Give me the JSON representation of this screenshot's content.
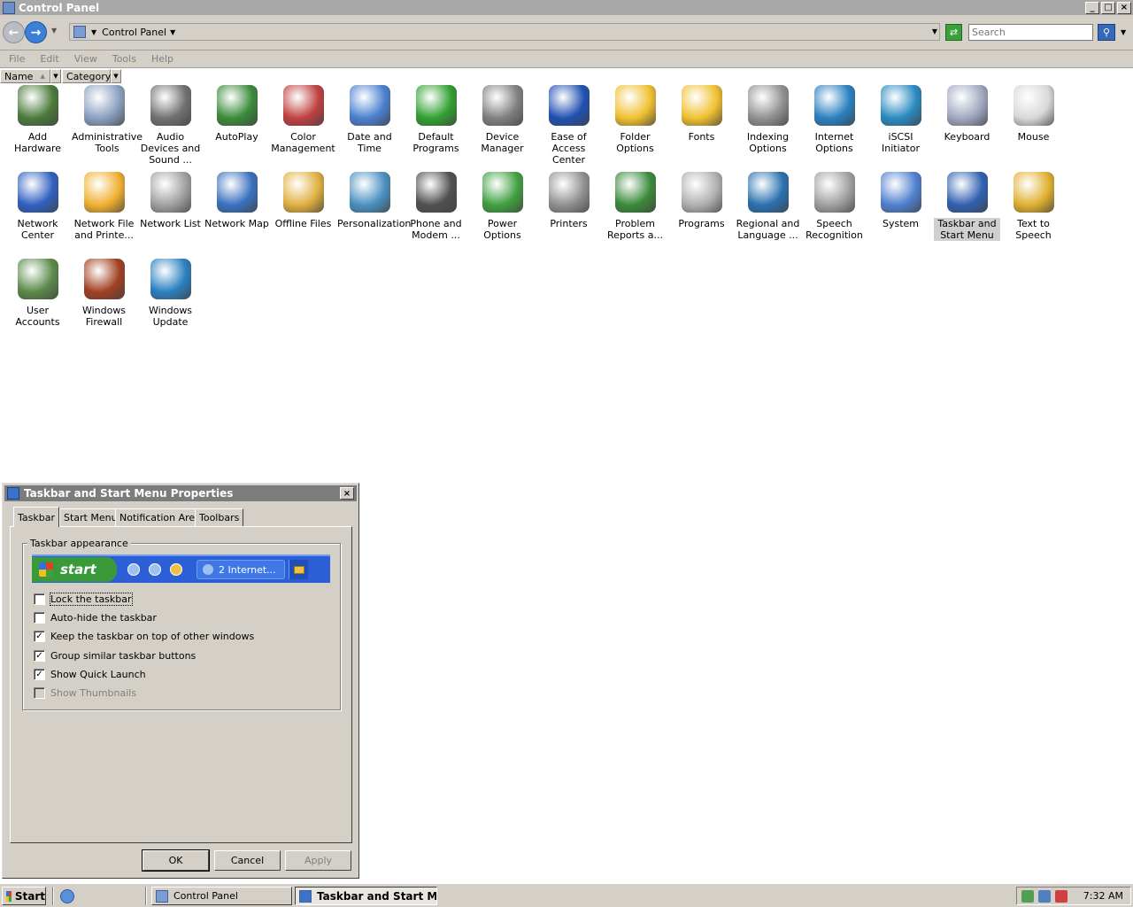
{
  "window": {
    "title": "Control Panel"
  },
  "address": {
    "crumb": "Control Panel",
    "search_placeholder": "Search"
  },
  "menu": [
    "File",
    "Edit",
    "View",
    "Tools",
    "Help"
  ],
  "columns": [
    "Name",
    "Category"
  ],
  "items": [
    {
      "label": "Add Hardware",
      "icon": "add-hardware-icon",
      "color": "#4a7a3a"
    },
    {
      "label": "Administrative Tools",
      "icon": "administrative-tools-icon",
      "color": "#8aa0c0"
    },
    {
      "label": "Audio Devices and Sound ...",
      "icon": "speaker-icon",
      "color": "#707070"
    },
    {
      "label": "AutoPlay",
      "icon": "autoplay-icon",
      "color": "#3a8a3a"
    },
    {
      "label": "Color Management",
      "icon": "color-management-icon",
      "color": "#c04040"
    },
    {
      "label": "Date and Time",
      "icon": "calendar-clock-icon",
      "color": "#4a80d0"
    },
    {
      "label": "Default Programs",
      "icon": "default-programs-icon",
      "color": "#30a030"
    },
    {
      "label": "Device Manager",
      "icon": "device-manager-icon",
      "color": "#808080"
    },
    {
      "label": "Ease of Access Center",
      "icon": "ease-of-access-icon",
      "color": "#2050b0"
    },
    {
      "label": "Folder Options",
      "icon": "folder-options-icon",
      "color": "#f0c030"
    },
    {
      "label": "Fonts",
      "icon": "fonts-folder-icon",
      "color": "#f0c030"
    },
    {
      "label": "Indexing Options",
      "icon": "indexing-icon",
      "color": "#909090"
    },
    {
      "label": "Internet Options",
      "icon": "internet-options-icon",
      "color": "#2a80c0"
    },
    {
      "label": "iSCSI Initiator",
      "icon": "iscsi-globe-icon",
      "color": "#2a8ac0"
    },
    {
      "label": "Keyboard",
      "icon": "keyboard-icon",
      "color": "#a0a8c0"
    },
    {
      "label": "Mouse",
      "icon": "mouse-icon",
      "color": "#d8d8d8"
    },
    {
      "label": "Network Center",
      "icon": "network-center-icon",
      "color": "#3060c0"
    },
    {
      "label": "Network File and Printe...",
      "icon": "network-file-icon",
      "color": "#f0b030"
    },
    {
      "label": "Network List",
      "icon": "network-list-icon",
      "color": "#a0a0a0"
    },
    {
      "label": "Network Map",
      "icon": "network-map-icon",
      "color": "#3a70c0"
    },
    {
      "label": "Offline Files",
      "icon": "offline-files-icon",
      "color": "#e0b040"
    },
    {
      "label": "Personalization",
      "icon": "personalization-icon",
      "color": "#4a90c0"
    },
    {
      "label": "Phone and Modem ...",
      "icon": "phone-modem-icon",
      "color": "#505050"
    },
    {
      "label": "Power Options",
      "icon": "battery-icon",
      "color": "#40a040"
    },
    {
      "label": "Printers",
      "icon": "printer-icon",
      "color": "#909090"
    },
    {
      "label": "Problem Reports a...",
      "icon": "problem-reports-icon",
      "color": "#3a8a3a"
    },
    {
      "label": "Programs",
      "icon": "programs-icon",
      "color": "#b0b0b0"
    },
    {
      "label": "Regional and Language ...",
      "icon": "globe-icon",
      "color": "#2a70b0"
    },
    {
      "label": "Speech Recognition",
      "icon": "microphone-icon",
      "color": "#a0a0a0"
    },
    {
      "label": "System",
      "icon": "system-icon",
      "color": "#5080d0"
    },
    {
      "label": "Taskbar and Start Menu",
      "icon": "taskbar-start-icon",
      "color": "#3060b0"
    },
    {
      "label": "Text to Speech",
      "icon": "text-to-speech-icon",
      "color": "#e0b030"
    },
    {
      "label": "User Accounts",
      "icon": "user-accounts-icon",
      "color": "#5a8a4a"
    },
    {
      "label": "Windows Firewall",
      "icon": "firewall-icon",
      "color": "#a04020"
    },
    {
      "label": "Windows Update",
      "icon": "windows-update-icon",
      "color": "#2a80c0"
    }
  ],
  "dialog": {
    "title": "Taskbar and Start Menu Properties",
    "tabs": [
      "Taskbar",
      "Start Menu",
      "Notification Area",
      "Toolbars"
    ],
    "group_title": "Taskbar appearance",
    "preview": {
      "start_label": "start",
      "task_label": "2 Internet..."
    },
    "options": [
      {
        "label": "Lock the taskbar",
        "checked": false,
        "disabled": false
      },
      {
        "label": "Auto-hide the taskbar",
        "checked": false,
        "disabled": false
      },
      {
        "label": "Keep the taskbar on top of other windows",
        "checked": true,
        "disabled": false
      },
      {
        "label": "Group similar taskbar buttons",
        "checked": true,
        "disabled": false
      },
      {
        "label": "Show Quick Launch",
        "checked": true,
        "disabled": false
      },
      {
        "label": "Show Thumbnails",
        "checked": false,
        "disabled": true
      }
    ],
    "buttons": {
      "ok": "OK",
      "cancel": "Cancel",
      "apply": "Apply"
    }
  },
  "taskbar": {
    "start_label": "Start",
    "tasks": [
      "Control Panel",
      "Taskbar and Start M..."
    ],
    "clock": "7:32 AM"
  }
}
